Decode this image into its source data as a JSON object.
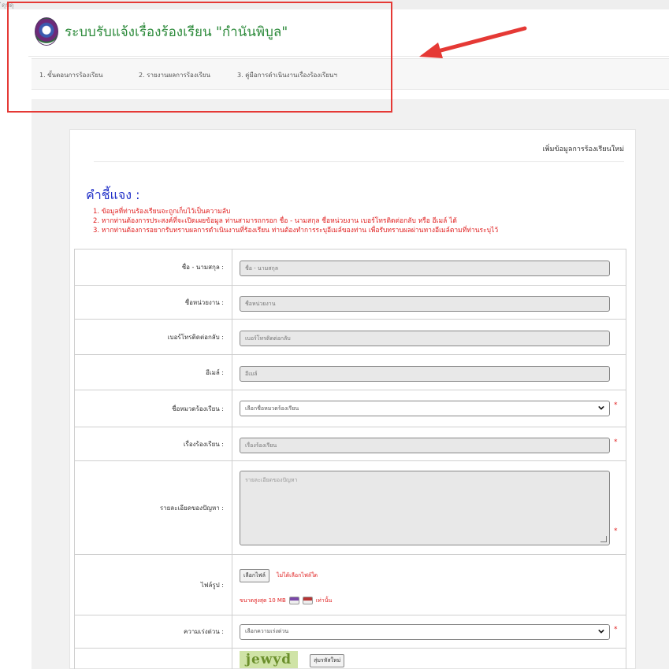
{
  "browser": {
    "url_fragment": "ิดุปดุ"
  },
  "header": {
    "title": "ระบบรับแจ้งเรื่องร้องเรียน \"กำนันพิบูล\""
  },
  "nav": {
    "items": [
      {
        "label": "1. ขั้นตอนการร้องเรียน"
      },
      {
        "label": "2. รายงานผลการร้องเรียน"
      },
      {
        "label": "3. คู่มือการดำเนินงานเรื่องร้องเรียนฯ"
      }
    ]
  },
  "card": {
    "title": "เพิ่มข้อมูลการร้องเรียนใหม่"
  },
  "instructions": {
    "heading": "คำชี้แจง :",
    "lines": [
      "1. ข้อมูลที่ท่านร้องเรียนจะถูกเก็บไว้เป็นความลับ",
      "2. หากท่านต้องการประสงค์ที่จะเปิดเผยข้อมูล ท่านสามารถกรอก ชื่อ - นามสกุล ชื่อหน่วยงาน เบอร์โทรติดต่อกลับ หรือ อีเมล์ ได้",
      "3. หากท่านต้องการอยากรับทราบผลการดำเนินงานที่ร้องเรียน ท่านต้องทำการระบุอีเมล์ของท่าน เพื่อรับทราบผลผ่านทางอีเมล์ตามที่ท่านระบุไว้"
    ]
  },
  "form": {
    "name": {
      "label": "ชื่อ - นามสกุล :",
      "placeholder": "ชื่อ - นามสกุล"
    },
    "agency": {
      "label": "ชื่อหน่วยงาน :",
      "placeholder": "ชื่อหน่วยงาน"
    },
    "phone": {
      "label": "เบอร์โทรติดต่อกลับ :",
      "placeholder": "เบอร์โทรติดต่อกลับ"
    },
    "email": {
      "label": "อีเมล์ :",
      "placeholder": "อีเมล์"
    },
    "category": {
      "label": "ชื่อหมวดร้องเรียน :",
      "selected": "เลือกชื่อหมวดร้องเรียน"
    },
    "subject": {
      "label": "เรื่องร้องเรียน :",
      "placeholder": "เรื่องร้องเรียน"
    },
    "details": {
      "label": "รายละเอียดของปัญหา :",
      "placeholder": "รายละเอียดของปัญหา"
    },
    "attachment": {
      "label": "ไฟล์รูป :",
      "button": "เลือกไฟล์",
      "no_file": "ไม่ได้เลือกไฟล์ใด",
      "max_prefix": "ขนาดสูงสุด 10 MB",
      "max_suffix": "เท่านั้น"
    },
    "urgency": {
      "label": "ความเร่งด่วน :",
      "selected": "เลือกความเร่งด่วน"
    },
    "captcha": {
      "text": "jewyd",
      "refresh": "สุ่มรหัสใหม่"
    },
    "required_mark": "*"
  },
  "colors": {
    "title_green": "#2e8b3c",
    "heading_blue": "#2231c8",
    "required_red": "#e02020",
    "annotation_red": "#e53935"
  }
}
